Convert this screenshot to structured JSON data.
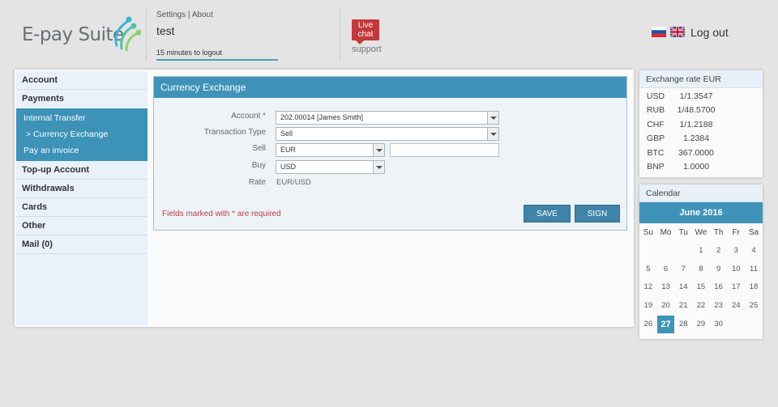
{
  "header": {
    "logo_text": "E-pay Suite",
    "user_links": "Settings | About",
    "user_name": "test",
    "logout_timer": "15 minutes to logout",
    "chat_label": "Live chat",
    "chat_support": "support",
    "logout_label": "Log out",
    "flags": [
      "flag-russia-icon",
      "flag-uk-icon"
    ]
  },
  "sidebar": {
    "items": [
      {
        "label": "Account"
      },
      {
        "label": "Payments"
      },
      {
        "label": "Top-up Account"
      },
      {
        "label": "Withdrawals"
      },
      {
        "label": "Cards"
      },
      {
        "label": "Other"
      },
      {
        "label": "Mail (0)"
      }
    ],
    "payments_sub": [
      {
        "label": "Internal Transfer"
      },
      {
        "label": "> Currency Exchange"
      },
      {
        "label": "Pay an invoice"
      }
    ]
  },
  "form": {
    "title": "Currency Exchange",
    "account_label": "Account *",
    "account_value": "202.00014 [James Smith]",
    "type_label": "Transaction Type",
    "type_value": "Sell",
    "sell_label": "Sell",
    "sell_value": "EUR",
    "sell_amount": "",
    "buy_label": "Buy",
    "buy_value": "USD",
    "rate_label": "Rate",
    "rate_value": "EUR/USD",
    "required_note": "Fields marked with * are required",
    "save_label": "SAVE",
    "sign_label": "SIGN"
  },
  "rates": {
    "title": "Exchange rate EUR",
    "rows": [
      {
        "cur": "USD",
        "val": "1/1.3547"
      },
      {
        "cur": "RUB",
        "val": "1/48.5700"
      },
      {
        "cur": "CHF",
        "val": "1/1.2188"
      },
      {
        "cur": "GBP",
        "val": "1.2384"
      },
      {
        "cur": "BTC",
        "val": "367.0000"
      },
      {
        "cur": "BNP",
        "val": "1.0000"
      }
    ]
  },
  "calendar": {
    "title": "Calendar",
    "month": "June 2016",
    "weekdays": [
      "Su",
      "Mo",
      "Tu",
      "We",
      "Th",
      "Fr",
      "Sa"
    ],
    "days": [
      "",
      "",
      "",
      "1",
      "2",
      "3",
      "4",
      "5",
      "6",
      "7",
      "8",
      "9",
      "10",
      "11",
      "12",
      "13",
      "14",
      "15",
      "16",
      "17",
      "18",
      "19",
      "20",
      "21",
      "22",
      "23",
      "24",
      "25",
      "26",
      "27",
      "28",
      "29",
      "30",
      "",
      ""
    ],
    "today": "27",
    "accent": "#3f93b9"
  }
}
